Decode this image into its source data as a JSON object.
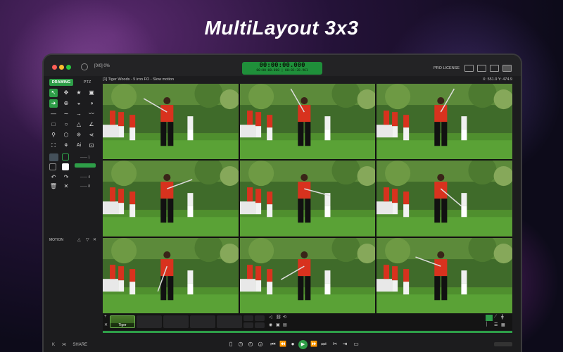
{
  "headline": "MultiLayout 3x3",
  "window": {
    "counter": "[0/0] 0%",
    "timecode_main": "00:00:00.000",
    "timecode_sub": "00:00:00.000 | 00:01:28.961",
    "license": "PRO LICENSE"
  },
  "sidebar": {
    "tab_drawing": "DRAWING",
    "tab_ptz": "PTZ",
    "motion_label": "MOTION",
    "share_label": "SHARE"
  },
  "viewer": {
    "title": "[1] Tiger Woods - 5 iron FO - Slow motion",
    "coords": "X: 551.9  Y: 474.9"
  },
  "strip": {
    "thumb_label": "Tiger"
  },
  "colors": {
    "accent": "#2e9e48",
    "grass": "#4f8f2e",
    "shirt": "#d8321e"
  }
}
